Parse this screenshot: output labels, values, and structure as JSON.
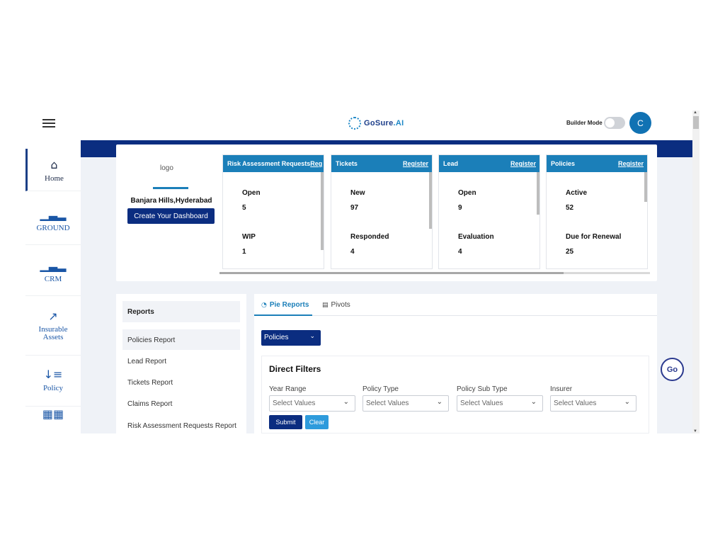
{
  "header": {
    "brand_main": "GoSure",
    "brand_sub": ".AI",
    "builder_mode_label": "Builder Mode",
    "avatar_initial": "C"
  },
  "sidebar": {
    "items": [
      {
        "label": "Home",
        "icon": "home-icon"
      },
      {
        "label": "GROUND",
        "icon": "bar-chart-icon"
      },
      {
        "label": "CRM",
        "icon": "bar-chart-icon"
      },
      {
        "label": "Insurable Assets",
        "icon": "trend-chart-icon"
      },
      {
        "label": "Policy",
        "icon": "sort-icon"
      }
    ]
  },
  "profile": {
    "logo_alt": "logo",
    "branch": "Banjara Hills,Hyderabad",
    "create_dashboard": "Create Your Dashboard"
  },
  "cards": [
    {
      "title": "Risk Assessment Requests",
      "register": "Reg",
      "stats": [
        {
          "label": "Open",
          "value": "5"
        },
        {
          "label": "WIP",
          "value": "1"
        }
      ]
    },
    {
      "title": "Tickets",
      "register": "Register",
      "stats": [
        {
          "label": "New",
          "value": "97"
        },
        {
          "label": "Responded",
          "value": "4"
        }
      ]
    },
    {
      "title": "Lead",
      "register": "Register",
      "stats": [
        {
          "label": "Open",
          "value": "9"
        },
        {
          "label": "Evaluation",
          "value": "4"
        }
      ]
    },
    {
      "title": "Policies",
      "register": "Register",
      "stats": [
        {
          "label": "Active",
          "value": "52"
        },
        {
          "label": "Due for Renewal",
          "value": "25"
        }
      ]
    }
  ],
  "reports": {
    "title": "Reports",
    "items": [
      "Policies Report",
      "Lead Report",
      "Tickets Report",
      "Claims Report",
      "Risk Assessment Requests Report"
    ]
  },
  "main": {
    "tabs": [
      {
        "label": "Pie Reports"
      },
      {
        "label": "Pivots"
      }
    ],
    "selected_report": "Policies",
    "filters_title": "Direct Filters",
    "filters": [
      {
        "label": "Year Range",
        "placeholder": "Select Values"
      },
      {
        "label": "Policy Type",
        "placeholder": "Select Values"
      },
      {
        "label": "Policy Sub Type",
        "placeholder": "Select Values"
      },
      {
        "label": "Insurer",
        "placeholder": "Select Values"
      }
    ],
    "submit": "Submit",
    "clear": "Clear"
  },
  "floating_badge": "Go",
  "colors": {
    "navy": "#0b2d80",
    "accent": "#1b7fb9",
    "bg": "#eff2f7"
  }
}
